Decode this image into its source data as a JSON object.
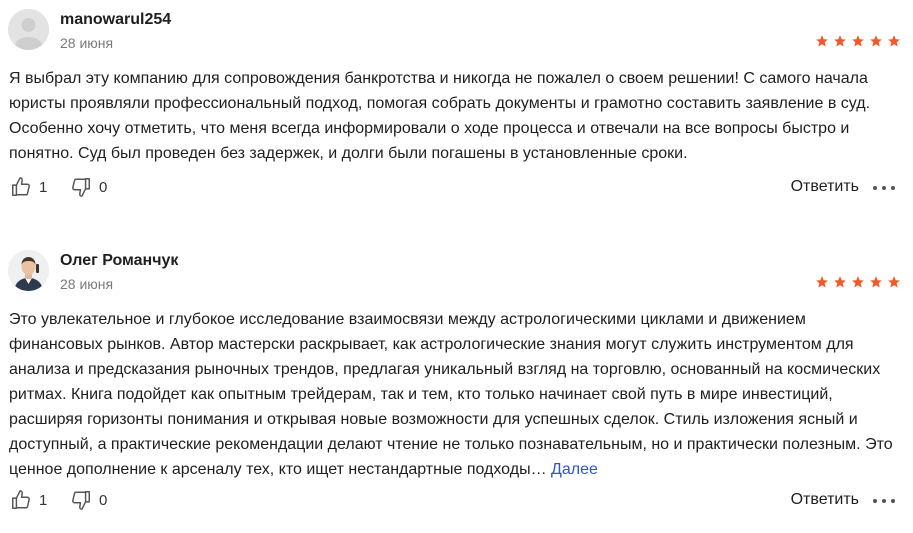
{
  "colors": {
    "star": "#f05a28",
    "link": "#2f56c4"
  },
  "reviews": [
    {
      "author": "manowarul254",
      "date": "28 июня",
      "rating": 5,
      "text": "Я выбрал эту компанию для сопровождения банкротства и никогда не пожалел о своем решении! С самого начала юристы проявляли профессиональный подход, помогая собрать документы и грамотно составить заявление в суд. Особенно хочу отметить, что меня всегда информировали о ходе процесса и отвечали на все вопросы быстро и понятно. Суд был проведен без задержек, и долги были погашены в установленные сроки.",
      "more_label": "",
      "likes": "1",
      "dislikes": "0",
      "reply_label": "Ответить"
    },
    {
      "author": "Олег Романчук",
      "date": "28 июня",
      "rating": 5,
      "text": "Это увлекательное и глубокое исследование взаимосвязи между астрологическими циклами и движением финансовых рынков. Автор мастерски раскрывает, как астрологические знания могут служить инструментом для анализа и предсказания рыночных трендов, предлагая уникальный взгляд на торговлю, основанный на космических ритмах. Книга подойдет как опытным трейдерам, так и тем, кто только начинает свой путь в мире инвестиций, расширяя горизонты понимания и открывая новые возможности для успешных сделок. Стиль изложения ясный и доступный, а практические рекомендации делают чтение не только познавательным, но и практически полезным. Это ценное дополнение к арсеналу тех, кто ищет нестандартные подходы…",
      "more_label": "Далее",
      "likes": "1",
      "dislikes": "0",
      "reply_label": "Ответить"
    }
  ]
}
